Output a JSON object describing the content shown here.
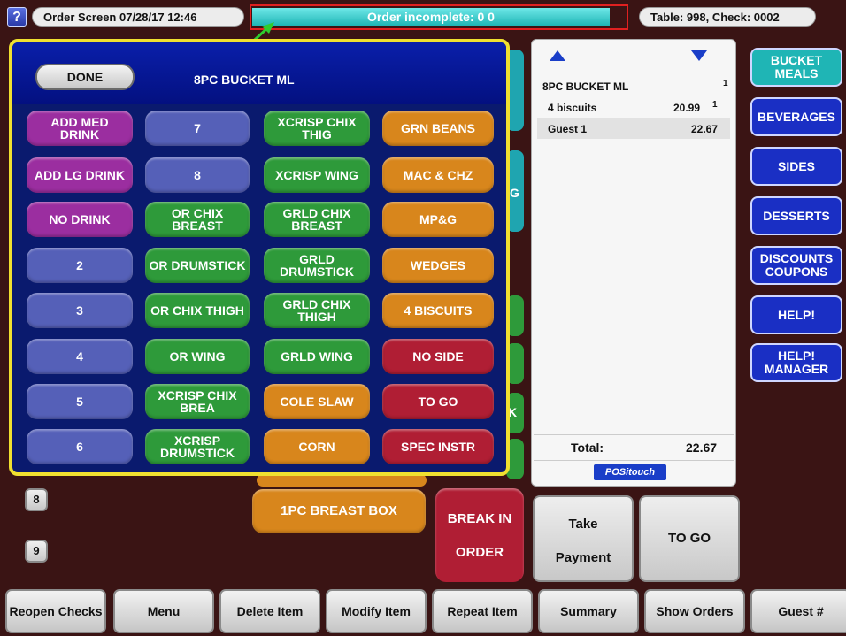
{
  "topbar": {
    "help_label": "?",
    "screen_info": "Order Screen 07/28/17 12:46",
    "status": "Order incomplete:  0  0",
    "table_check": "Table: 998, Check: 0002"
  },
  "popup": {
    "done_label": "DONE",
    "title": "8PC BUCKET ML",
    "columns": [
      [
        {
          "label": "ADD MED DRINK",
          "color": "purple"
        },
        {
          "label": "ADD LG DRINK",
          "color": "purple"
        },
        {
          "label": "NO DRINK",
          "color": "purple"
        },
        {
          "label": "2",
          "color": "blue"
        },
        {
          "label": "3",
          "color": "blue"
        },
        {
          "label": "4",
          "color": "blue"
        },
        {
          "label": "5",
          "color": "blue"
        },
        {
          "label": "6",
          "color": "blue"
        }
      ],
      [
        {
          "label": "7",
          "color": "blue"
        },
        {
          "label": "8",
          "color": "blue"
        },
        {
          "label": "OR CHIX BREAST",
          "color": "green"
        },
        {
          "label": "OR DRUMSTICK",
          "color": "green"
        },
        {
          "label": "OR CHIX THIGH",
          "color": "green"
        },
        {
          "label": "OR WING",
          "color": "green"
        },
        {
          "label": "XCRISP CHIX BREA",
          "color": "green"
        },
        {
          "label": "XCRISP DRUMSTICK",
          "color": "green"
        }
      ],
      [
        {
          "label": "XCRISP CHIX THIG",
          "color": "green"
        },
        {
          "label": "XCRISP WING",
          "color": "green"
        },
        {
          "label": "GRLD CHIX BREAST",
          "color": "green"
        },
        {
          "label": "GRLD DRUMSTICK",
          "color": "green"
        },
        {
          "label": "GRLD CHIX THIGH",
          "color": "green"
        },
        {
          "label": "GRLD WING",
          "color": "green"
        },
        {
          "label": "COLE SLAW",
          "color": "orange"
        },
        {
          "label": "CORN",
          "color": "orange"
        }
      ],
      [
        {
          "label": "GRN BEANS",
          "color": "orange"
        },
        {
          "label": "MAC & CHZ",
          "color": "orange"
        },
        {
          "label": "MP&G",
          "color": "orange"
        },
        {
          "label": "WEDGES",
          "color": "orange"
        },
        {
          "label": "4 BISCUITS",
          "color": "orange"
        },
        {
          "label": "NO SIDE",
          "color": "red"
        },
        {
          "label": "TO GO",
          "color": "red"
        },
        {
          "label": "SPEC INSTR",
          "color": "red"
        }
      ]
    ]
  },
  "receipt": {
    "scroll_up_icon": "triangle-up",
    "scroll_down_icon": "triangle-down",
    "item_name": "8PC BUCKET ML",
    "item_qty": "1",
    "sub_name": "4 biscuits",
    "sub_price": "20.99",
    "sub_qty": "1",
    "guest_label": "Guest 1",
    "guest_total": "22.67",
    "total_label": "Total:",
    "total_value": "22.67",
    "brand": "POSitouch"
  },
  "right_nav": [
    {
      "label": "BUCKET MEALS",
      "active": true
    },
    {
      "label": "BEVERAGES",
      "active": false
    },
    {
      "label": "SIDES",
      "active": false
    },
    {
      "label": "DESSERTS",
      "active": false
    },
    {
      "label": "DISCOUNTS COUPONS",
      "active": false
    },
    {
      "label": "HELP!",
      "active": false
    },
    {
      "label": "HELP! MANAGER",
      "active": false
    }
  ],
  "background_tabs": {
    "g_label": "G",
    "k_label": "K"
  },
  "left_numbers": [
    "8",
    "9"
  ],
  "middle": {
    "breast_box": "1PC BREAST BOX",
    "break_in_line1": "BREAK IN",
    "break_in_line2": "ORDER",
    "take_payment_line1": "Take",
    "take_payment_line2": "Payment",
    "to_go": "TO GO"
  },
  "bottom_bar": [
    {
      "label": "Reopen Checks"
    },
    {
      "label": "Menu"
    },
    {
      "label": "Delete Item"
    },
    {
      "label": "Modify Item"
    },
    {
      "label": "Repeat Item"
    },
    {
      "label": "Summary"
    },
    {
      "label": "Show Orders"
    },
    {
      "label": "Guest #"
    }
  ],
  "colors": {
    "purple": "#9b2ea0",
    "blue": "#5560b8",
    "green": "#2e9a3a",
    "orange": "#d8861c",
    "red": "#b01e34",
    "teal": "#1fb5b5",
    "accent_yellow": "#f0e030"
  }
}
